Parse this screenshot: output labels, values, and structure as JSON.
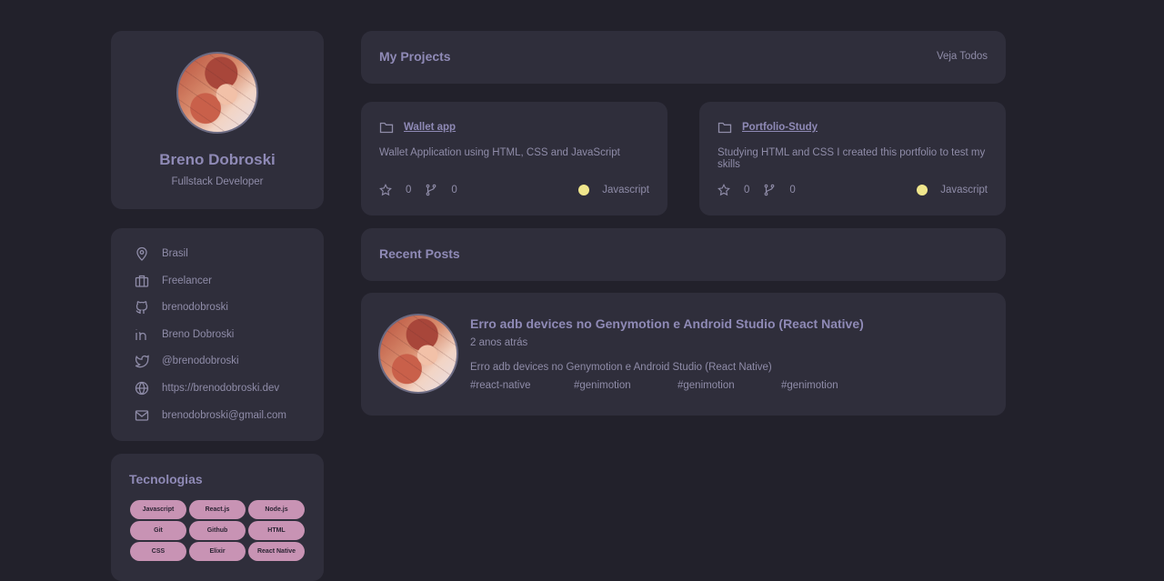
{
  "profile": {
    "name": "Breno Dobroski",
    "role": "Fullstack Developer"
  },
  "info": [
    {
      "icon": "location-pin-icon",
      "text": "Brasil"
    },
    {
      "icon": "briefcase-icon",
      "text": "Freelancer"
    },
    {
      "icon": "github-icon",
      "text": "brenodobroski"
    },
    {
      "icon": "linkedin-icon",
      "text": "Breno Dobroski"
    },
    {
      "icon": "twitter-icon",
      "text": "@brenodobroski"
    },
    {
      "icon": "globe-icon",
      "text": "https://brenodobroski.dev"
    },
    {
      "icon": "mail-icon",
      "text": "brenodobroski@gmail.com"
    }
  ],
  "tech": {
    "title": "Tecnologias",
    "items": [
      "Javascript",
      "React.js",
      "Node.js",
      "Git",
      "Github",
      "HTML",
      "CSS",
      "Elixir",
      "React Native"
    ]
  },
  "projects_section": {
    "title": "My Projects",
    "see_all": "Veja Todos"
  },
  "projects": [
    {
      "name": "Wallet app",
      "description": "Wallet Application using HTML, CSS and JavaScript",
      "stars": "0",
      "forks": "0",
      "language": "Javascript"
    },
    {
      "name": "Portfolio-Study",
      "description": "Studying HTML and CSS I created this portfolio to test my skills",
      "stars": "0",
      "forks": "0",
      "language": "Javascript"
    }
  ],
  "posts_section": {
    "title": "Recent Posts"
  },
  "post": {
    "title": "Erro adb devices no Genymotion e Android Studio (React Native)",
    "date": "2 anos atrás",
    "excerpt": "Erro adb devices no Genymotion e Android Studio (React Native)",
    "tags": [
      "#react-native",
      "#genimotion",
      "#genimotion",
      "#genimotion"
    ]
  },
  "colors": {
    "background": "#22212b",
    "card": "#2f2e3b",
    "accent_text": "#8f8ab6",
    "tech_pill": "#c893b4",
    "language_dot": "#f0e68c"
  }
}
